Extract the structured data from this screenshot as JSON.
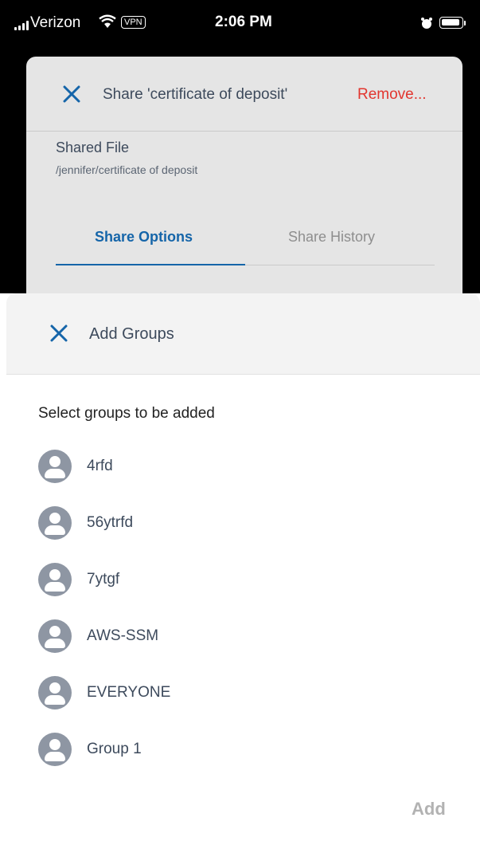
{
  "status_bar": {
    "carrier": "Verizon",
    "vpn": "VPN",
    "time": "2:06 PM"
  },
  "share_dialog": {
    "title": "Share 'certificate of deposit'",
    "remove_label": "Remove...",
    "shared_file_label": "Shared File",
    "shared_file_path": "/jennifer/certificate of deposit",
    "tabs": [
      {
        "label": "Share Options",
        "active": true
      },
      {
        "label": "Share History",
        "active": false
      }
    ]
  },
  "add_groups_sheet": {
    "title": "Add Groups",
    "instruction": "Select groups to be added",
    "groups": [
      {
        "name": "4rfd"
      },
      {
        "name": "56ytrfd"
      },
      {
        "name": "7ytgf"
      },
      {
        "name": "AWS-SSM"
      },
      {
        "name": "EVERYONE"
      },
      {
        "name": "Group 1"
      }
    ],
    "add_label": "Add"
  },
  "colors": {
    "accent": "#1565a9",
    "danger": "#e2362f",
    "avatar": "#8e96a3",
    "disabled": "#b2b2b2"
  }
}
